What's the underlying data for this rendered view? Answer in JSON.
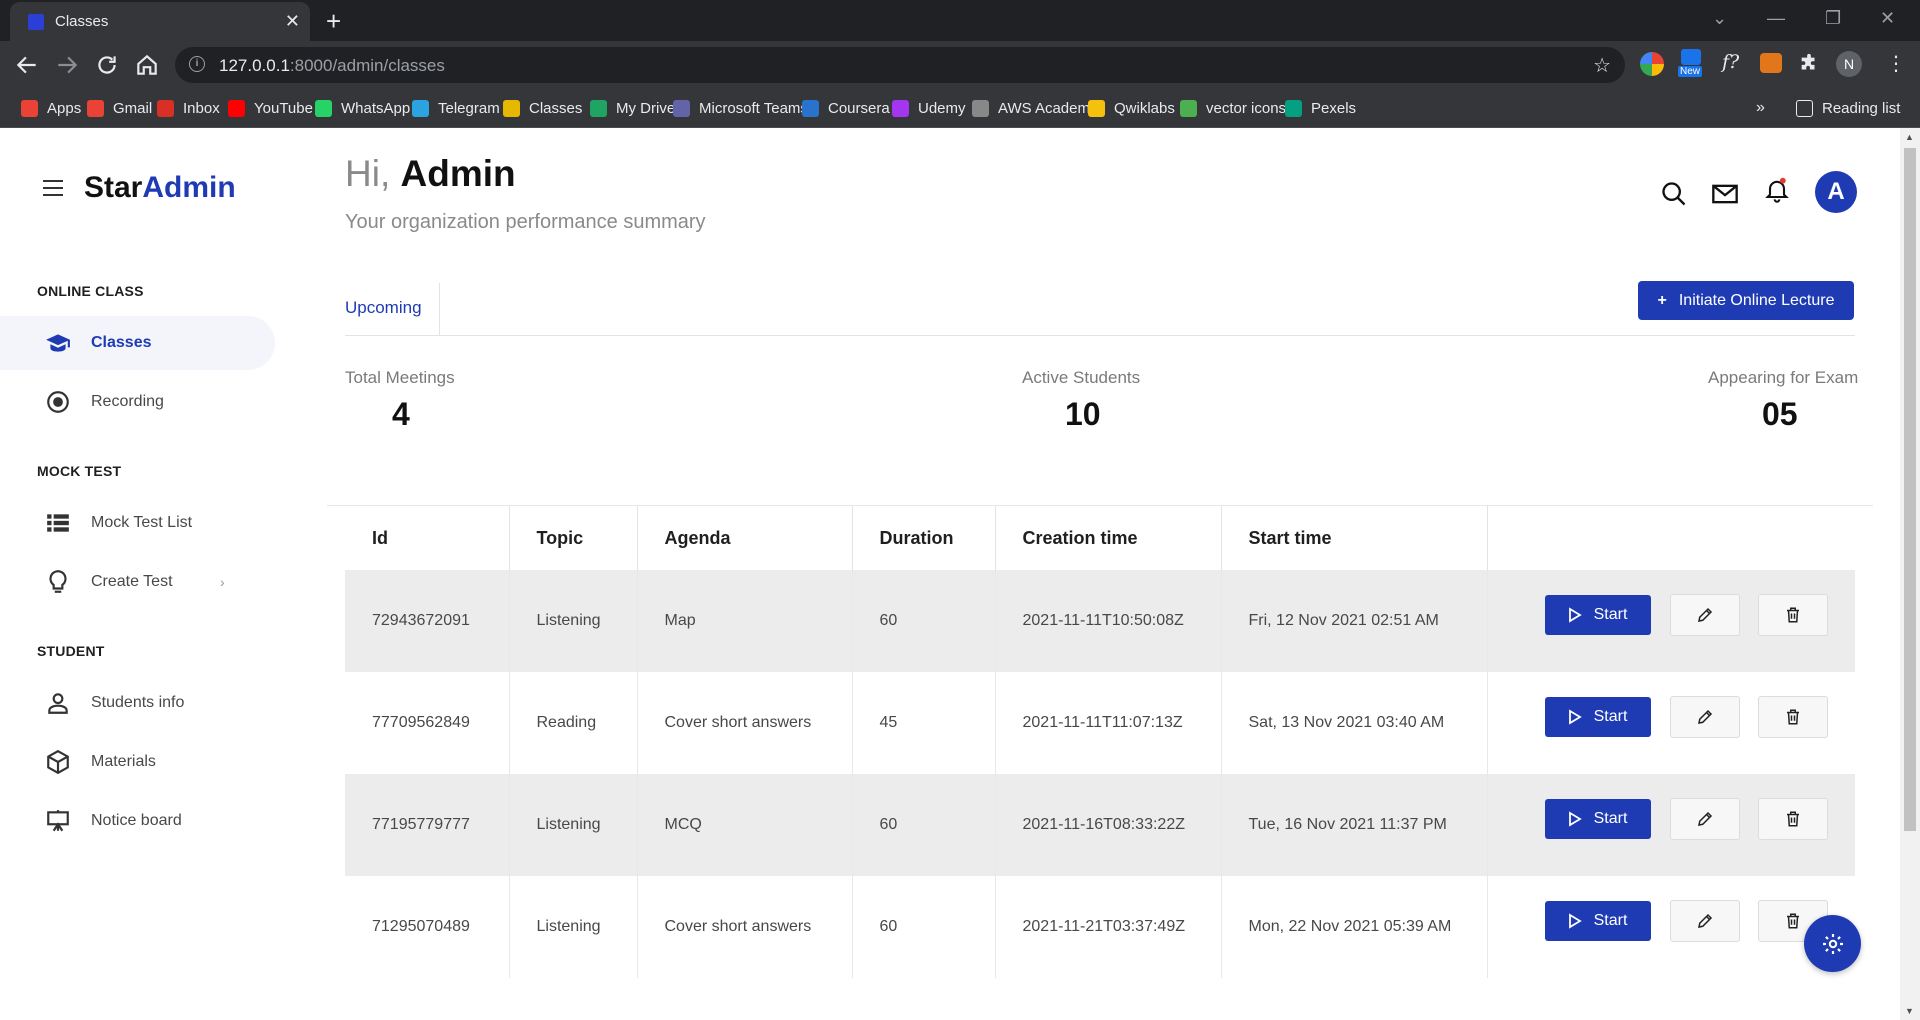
{
  "browser": {
    "tab_title": "Classes",
    "url_host": "127.0.0.1",
    "url_path": ":8000/admin/classes",
    "bookmarks": [
      "Apps",
      "Gmail",
      "Inbox",
      "YouTube",
      "WhatsApp",
      "Telegram",
      "Classes",
      "My Drive",
      "Microsoft Teams",
      "Coursera",
      "Udemy",
      "AWS Academy",
      "Qwiklabs",
      "vector icons",
      "Pexels"
    ],
    "bookmark_colors": [
      "#ea4335",
      "#ea4335",
      "#d93025",
      "#ff0000",
      "#25d366",
      "#2aa3e0",
      "#e6b800",
      "#1fa463",
      "#6264a7",
      "#2a73cc",
      "#a435f0",
      "#888888",
      "#f4c20d",
      "#4caf50",
      "#05a081"
    ],
    "overflow": "»",
    "reading_list": "Reading list",
    "new_badge": "New",
    "profile_initial": "N",
    "fx_label": "f?"
  },
  "brand": {
    "part1": "Star",
    "part2": "Admin"
  },
  "sidebar": {
    "sections": [
      {
        "heading": "ONLINE CLASS",
        "items": [
          {
            "label": "Classes",
            "icon": "graduation-cap-icon",
            "active": true
          },
          {
            "label": "Recording",
            "icon": "record-icon"
          }
        ]
      },
      {
        "heading": "MOCK TEST",
        "items": [
          {
            "label": "Mock Test List",
            "icon": "list-icon"
          },
          {
            "label": "Create Test",
            "icon": "lightbulb-icon",
            "chevron": "›"
          }
        ]
      },
      {
        "heading": "STUDENT",
        "items": [
          {
            "label": "Students info",
            "icon": "person-icon"
          },
          {
            "label": "Materials",
            "icon": "cube-icon"
          },
          {
            "label": "Notice board",
            "icon": "easel-icon"
          }
        ]
      }
    ]
  },
  "header": {
    "greeting_prefix": "Hi, ",
    "greeting_name": "Admin",
    "subtitle": "Your organization performance summary",
    "avatar_initial": "A"
  },
  "tabs": {
    "upcoming": "Upcoming"
  },
  "actions": {
    "initiate": "Initiate Online Lecture",
    "plus": "+"
  },
  "stats": [
    {
      "label": "Total Meetings",
      "value": "4"
    },
    {
      "label": "Active Students",
      "value": "10"
    },
    {
      "label": "Appearing for Exam",
      "value": "05"
    }
  ],
  "table": {
    "columns": [
      "Id",
      "Topic",
      "Agenda",
      "Duration",
      "Creation time",
      "Start time",
      ""
    ],
    "rows": [
      {
        "id": "72943672091",
        "topic": "Listening",
        "agenda": "Map",
        "duration": "60",
        "created": "2021-11-11T10:50:08Z",
        "start": "Fri, 12 Nov 2021 02:51 AM"
      },
      {
        "id": "77709562849",
        "topic": "Reading",
        "agenda": "Cover short answers",
        "duration": "45",
        "created": "2021-11-11T11:07:13Z",
        "start": "Sat, 13 Nov 2021 03:40 AM"
      },
      {
        "id": "77195779777",
        "topic": "Listening",
        "agenda": "MCQ",
        "duration": "60",
        "created": "2021-11-16T08:33:22Z",
        "start": "Tue, 16 Nov 2021 11:37 PM"
      },
      {
        "id": "71295070489",
        "topic": "Listening",
        "agenda": "Cover short answers",
        "duration": "60",
        "created": "2021-11-21T03:37:49Z",
        "start": "Mon, 22 Nov 2021 05:39 AM"
      }
    ],
    "start_label": "Start"
  },
  "colors": {
    "accent": "#1f3bb3",
    "chrome_dark": "#202124",
    "chrome": "#35363a"
  }
}
